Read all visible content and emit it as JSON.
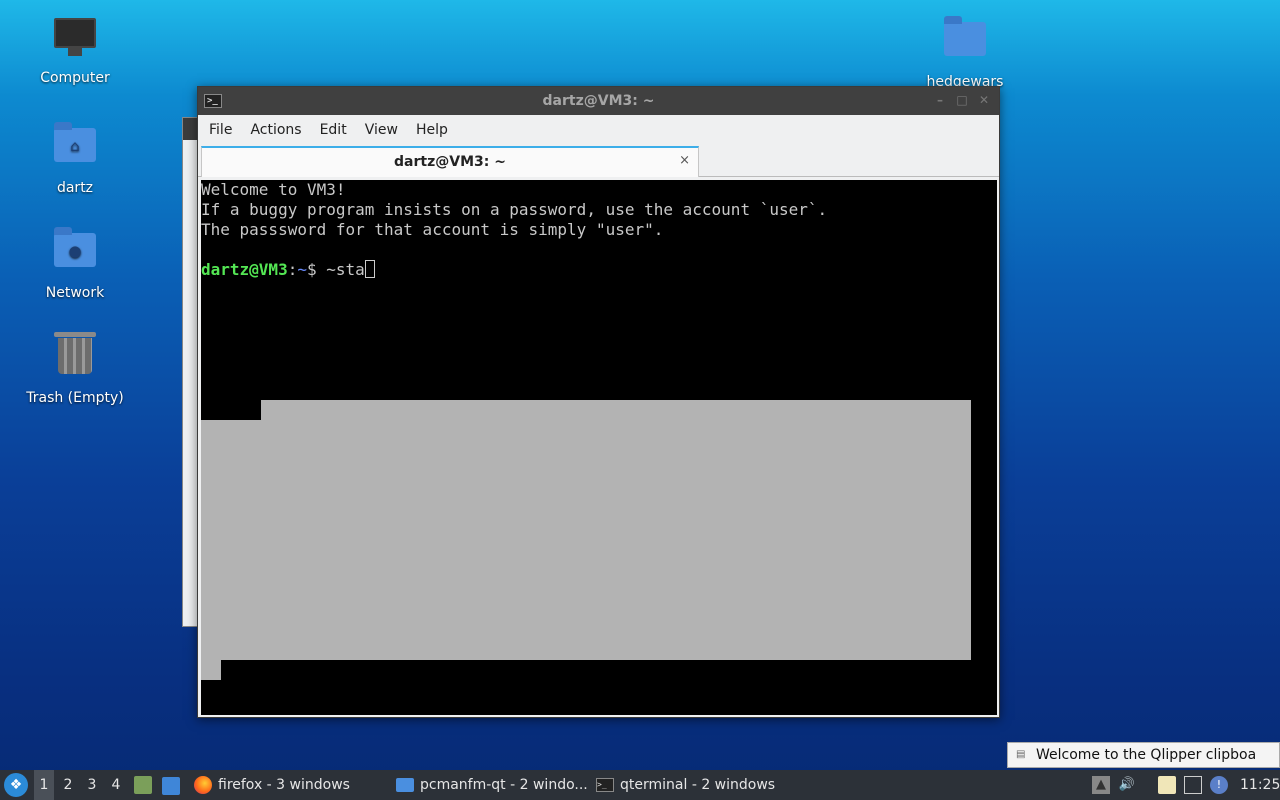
{
  "desktop": {
    "icons": [
      {
        "label": "Computer"
      },
      {
        "label": "dartz"
      },
      {
        "label": "Network"
      },
      {
        "label": "Trash (Empty)"
      },
      {
        "label": "hedgewars"
      }
    ]
  },
  "terminal": {
    "title": "dartz@VM3: ~",
    "menu": [
      "File",
      "Actions",
      "Edit",
      "View",
      "Help"
    ],
    "tab_label": "dartz@VM3: ~",
    "tab_close": "×",
    "lines": [
      "Welcome to VM3!",
      "If a buggy program insists on a password, use the account `user`.",
      "The passsword for that account is simply \"user\"."
    ],
    "prompt_user": "dartz@VM3",
    "prompt_sep": ":",
    "prompt_path": "~",
    "prompt_symbol": "$ ",
    "command": "~sta"
  },
  "notification": {
    "text": "Welcome to the Qlipper clipboa"
  },
  "taskbar": {
    "desktops": [
      "1",
      "2",
      "3",
      "4"
    ],
    "tasks": [
      {
        "label": "firefox - 3 windows",
        "icon": "firefox-icon"
      },
      {
        "label": "pcmanfm-qt - 2 windo...",
        "icon": "folder-icon"
      },
      {
        "label": "qterminal - 2 windows",
        "icon": "terminal-icon"
      }
    ],
    "clock": "11:25"
  }
}
